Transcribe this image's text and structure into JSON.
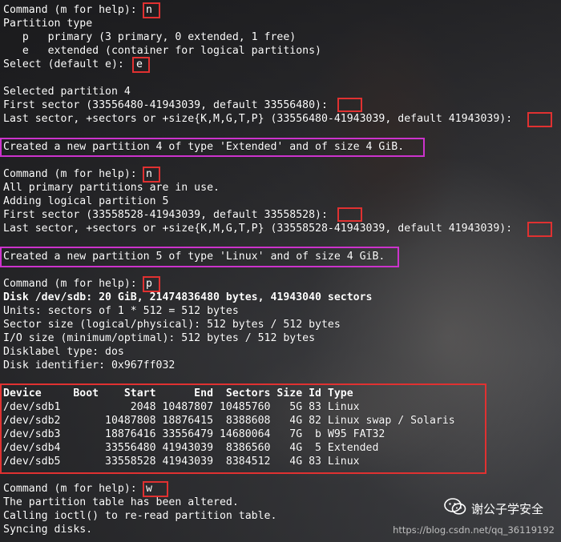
{
  "terminal": {
    "lines": [
      "Command (m for help): ",
      "Partition type",
      "   p   primary (3 primary, 0 extended, 1 free)",
      "   e   extended (container for logical partitions)",
      "Select (default e): ",
      "",
      "Selected partition 4",
      "First sector (33556480-41943039, default 33556480): ",
      "Last sector, +sectors or +size{K,M,G,T,P} (33556480-41943039, default 41943039): ",
      "",
      "Created a new partition 4 of type 'Extended' and of size 4 GiB.",
      "",
      "Command (m for help): ",
      "All primary partitions are in use.",
      "Adding logical partition 5",
      "First sector (33558528-41943039, default 33558528): ",
      "Last sector, +sectors or +size{K,M,G,T,P} (33558528-41943039, default 41943039): ",
      "",
      "Created a new partition 5 of type 'Linux' and of size 4 GiB.",
      "",
      "Command (m for help): ",
      "Disk /dev/sdb: 20 GiB, 21474836480 bytes, 41943040 sectors",
      "Units: sectors of 1 * 512 = 512 bytes",
      "Sector size (logical/physical): 512 bytes / 512 bytes",
      "I/O size (minimum/optimal): 512 bytes / 512 bytes",
      "Disklabel type: dos",
      "Disk identifier: 0x967ff032",
      "",
      "",
      "Device     Boot    Start      End  Sectors Size Id Type",
      "/dev/sdb1           2048 10487807 10485760   5G 83 Linux",
      "/dev/sdb2       10487808 18876415  8388608   4G 82 Linux swap / Solaris",
      "/dev/sdb3       18876416 33556479 14680064   7G  b W95 FAT32",
      "/dev/sdb4       33556480 41943039  8386560   4G  5 Extended",
      "/dev/sdb5       33558528 41943039  8384512   4G 83 Linux",
      "",
      "Command (m for help): ",
      "The partition table has been altered.",
      "Calling ioctl() to re-read partition table.",
      "Syncing disks."
    ],
    "typed_inputs": {
      "cmd1": "n",
      "select": "e",
      "cmd2": "n",
      "cmd3": "p",
      "cmd4": "w"
    }
  },
  "partition_table": {
    "columns": [
      "Device",
      "Boot",
      "Start",
      "End",
      "Sectors",
      "Size",
      "Id",
      "Type"
    ],
    "rows": [
      [
        "/dev/sdb1",
        "",
        "2048",
        "10487807",
        "10485760",
        "5G",
        "83",
        "Linux"
      ],
      [
        "/dev/sdb2",
        "",
        "10487808",
        "18876415",
        "8388608",
        "4G",
        "82",
        "Linux swap / Solaris"
      ],
      [
        "/dev/sdb3",
        "",
        "18876416",
        "33556479",
        "14680064",
        "7G",
        "b",
        "W95 FAT32"
      ],
      [
        "/dev/sdb4",
        "",
        "33556480",
        "41943039",
        "8386560",
        "4G",
        "5",
        "Extended"
      ],
      [
        "/dev/sdb5",
        "",
        "33558528",
        "41943039",
        "8384512",
        "4G",
        "83",
        "Linux"
      ]
    ]
  },
  "overlay": {
    "wechat_label": "谢公子学安全",
    "watermark": "https://blog.csdn.net/qq_36119192"
  },
  "colors": {
    "highlight_red": "#e03131",
    "highlight_magenta": "#cc33cc",
    "text": "#ffffff"
  },
  "icons": [
    "wechat-icon"
  ]
}
